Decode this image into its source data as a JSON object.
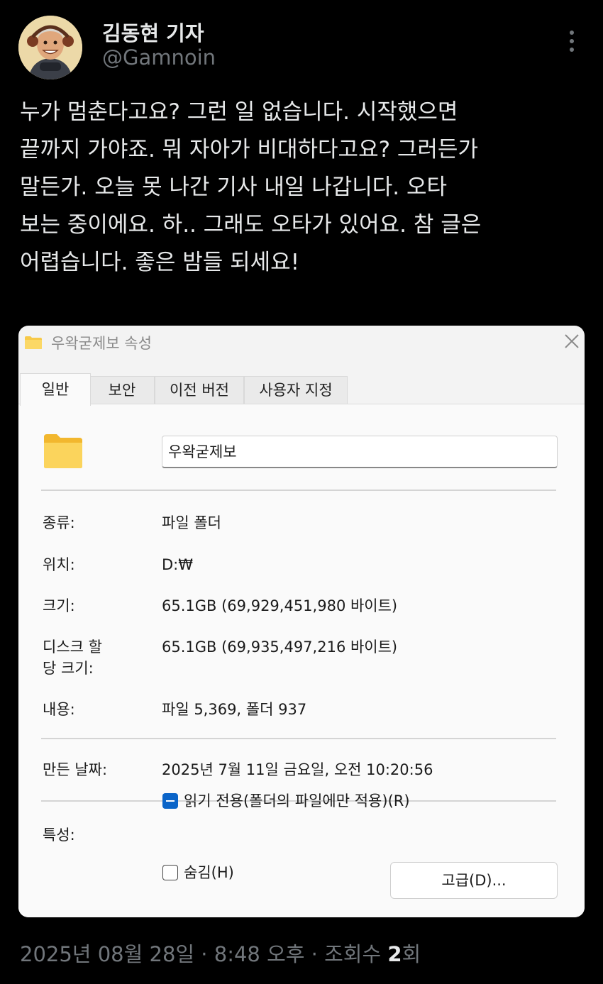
{
  "author": {
    "name": "김동현 기자",
    "handle": "@Gamnoin"
  },
  "tweet": {
    "lines": [
      "누가 멈춘다고요? 그런 일 없습니다. 시작했으면",
      "끝까지 가야죠. 뭐 자아가 비대하다고요? 그러든가",
      "말든가. 오늘 못 나간 기사 내일 나갑니다. 오타",
      "보는 중이에요. 하.. 그래도 오타가 있어요. 참 글은",
      "어렵습니다. 좋은 밤들 되세요!"
    ]
  },
  "dialog": {
    "title": "우왁굳제보 속성",
    "tabs": [
      "일반",
      "보안",
      "이전 버전",
      "사용자 지정"
    ],
    "folder_name": "우왁굳제보",
    "properties": {
      "type_label": "종류:",
      "type_value": "파일 폴더",
      "location_label": "위치:",
      "location_value": "D:₩",
      "size_label": "크기:",
      "size_value": "65.1GB (69,929,451,980 바이트)",
      "disk_size_label_1": "디스크 할",
      "disk_size_label_2": "당 크기:",
      "disk_size_value": "65.1GB (69,935,497,216 바이트)",
      "contents_label": "내용:",
      "contents_value": "파일 5,369, 폴더 937",
      "created_label": "만든 날짜:",
      "created_value": "2025년 7월 11일 금요일, 오전 10:20:56",
      "attributes_label": "특성:",
      "readonly_label": "읽기 전용(폴더의 파일에만 적용)(R)",
      "hidden_label": "숨김(H)",
      "advanced_button": "고급(D)..."
    }
  },
  "meta": {
    "timestamp": "2025년 08월 28일 · 8:48 오후 · 조회수 ",
    "views": "2",
    "views_unit": "회"
  },
  "icons": {
    "more": "more-vertical-icon",
    "folder": "folder-icon",
    "close": "close-icon"
  },
  "colors": {
    "background": "#000000",
    "text": "#e7e9ea",
    "secondary_text": "#71767b",
    "folder_yellow": "#f7c948",
    "checkbox_blue": "#0a64c8"
  }
}
